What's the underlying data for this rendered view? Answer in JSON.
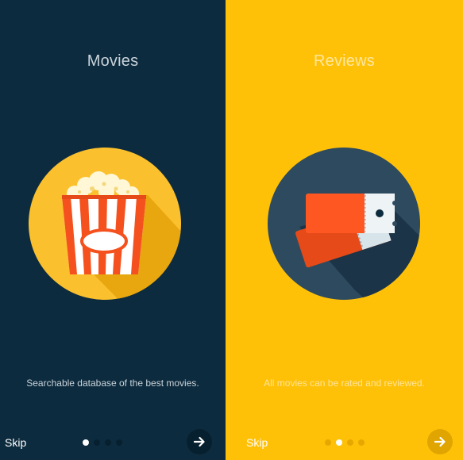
{
  "screens": [
    {
      "title": "Movies",
      "description": "Searchable database of the best movies.",
      "skip_label": "Skip",
      "icon": "popcorn-icon",
      "page_count": 4,
      "active_page": 1,
      "next_icon": "arrow-right-icon",
      "colors": {
        "background": "#0d2b3e",
        "circle": "#fbc02d"
      }
    },
    {
      "title": "Reviews",
      "description": "All movies can be rated and reviewed.",
      "skip_label": "Skip",
      "icon": "tickets-icon",
      "page_count": 4,
      "active_page": 2,
      "next_icon": "arrow-right-icon",
      "colors": {
        "background": "#ffc107",
        "circle": "#2e4a5f"
      }
    }
  ]
}
